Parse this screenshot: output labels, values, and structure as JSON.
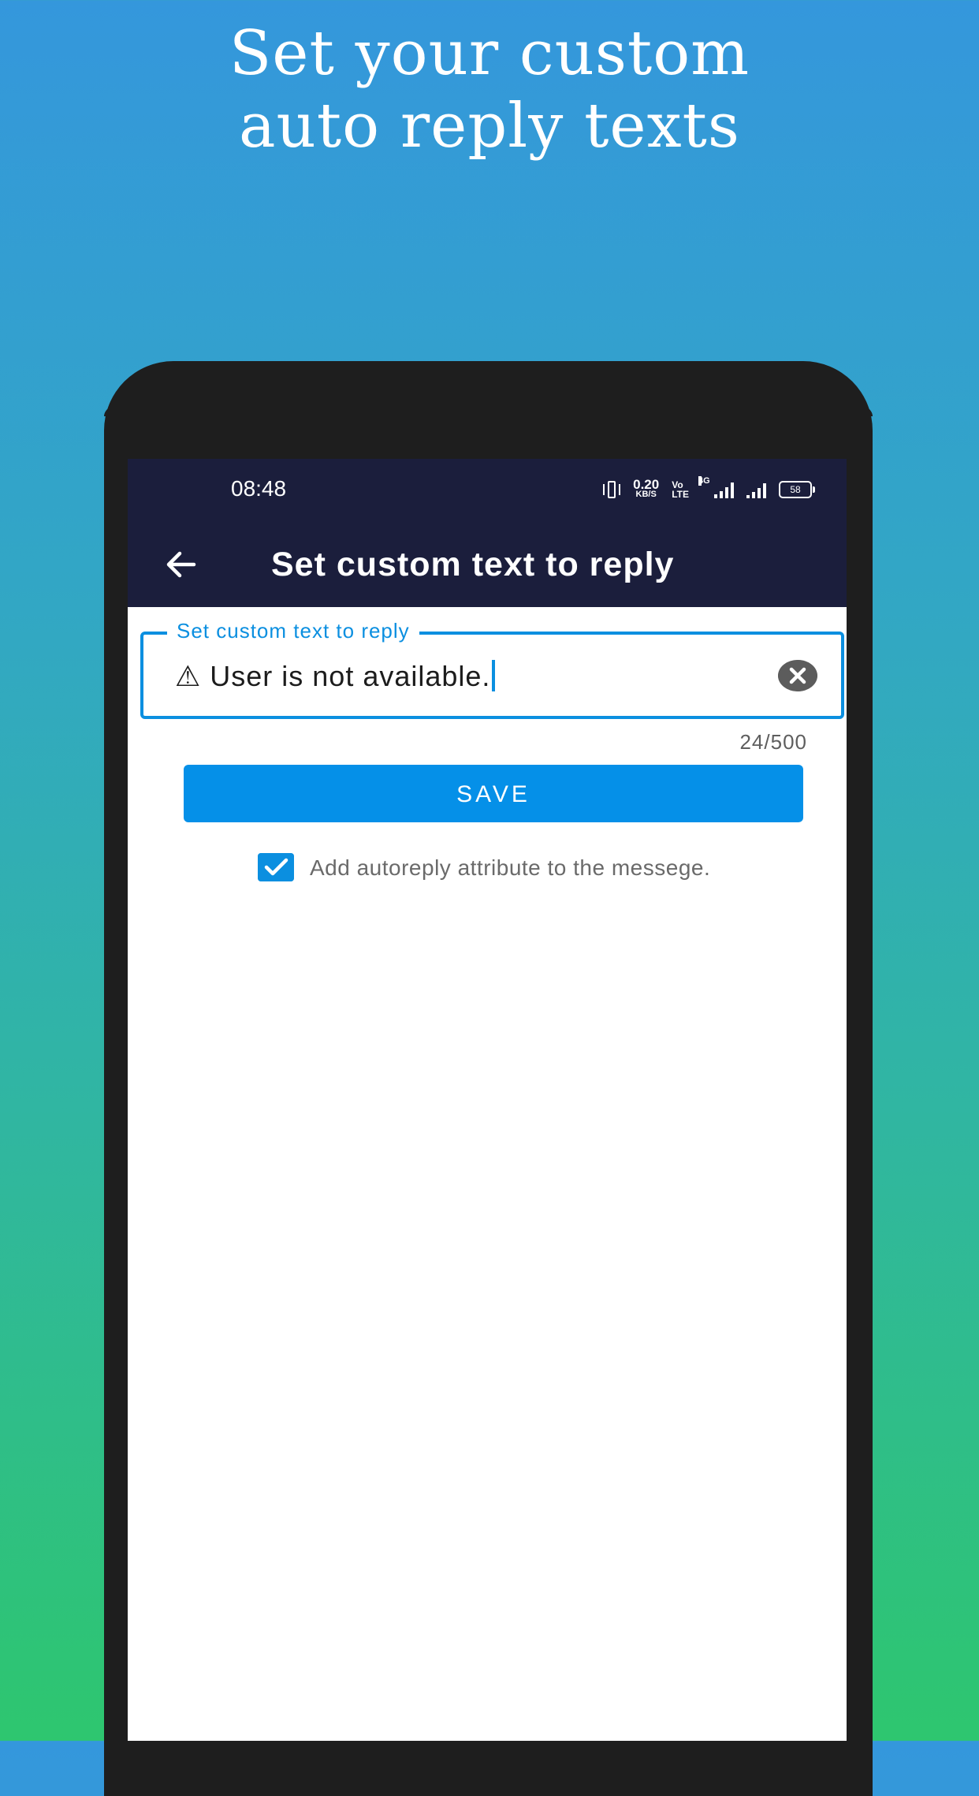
{
  "promo": {
    "title_line1": "Set your custom",
    "title_line2": "auto reply texts"
  },
  "status_bar": {
    "time": "08:48",
    "net_speed_value": "0.20",
    "net_speed_unit": "KB/S",
    "volte_top": "Vo",
    "volte_bottom": "LTE",
    "network_type": "4G",
    "battery": "58",
    "icons": [
      "vibrate-icon",
      "net-speed-icon",
      "volte-icon",
      "signal-4g-icon",
      "signal-icon",
      "battery-icon"
    ]
  },
  "app_bar": {
    "back_icon": "arrow-left-icon",
    "title": "Set custom text to reply"
  },
  "form": {
    "field_label": "Set custom text to reply",
    "field_value": "⚠ User is not available.",
    "clear_icon": "close-circle-icon",
    "char_counter": "24/500",
    "save_label": "SAVE",
    "checkbox_checked": true,
    "checkbox_label": "Add autoreply attribute to the messege."
  },
  "colors": {
    "accent": "#0b8fe0",
    "button": "#0590e8",
    "app_bar": "#1b1e3c",
    "phone_frame": "#1e1e1e"
  }
}
